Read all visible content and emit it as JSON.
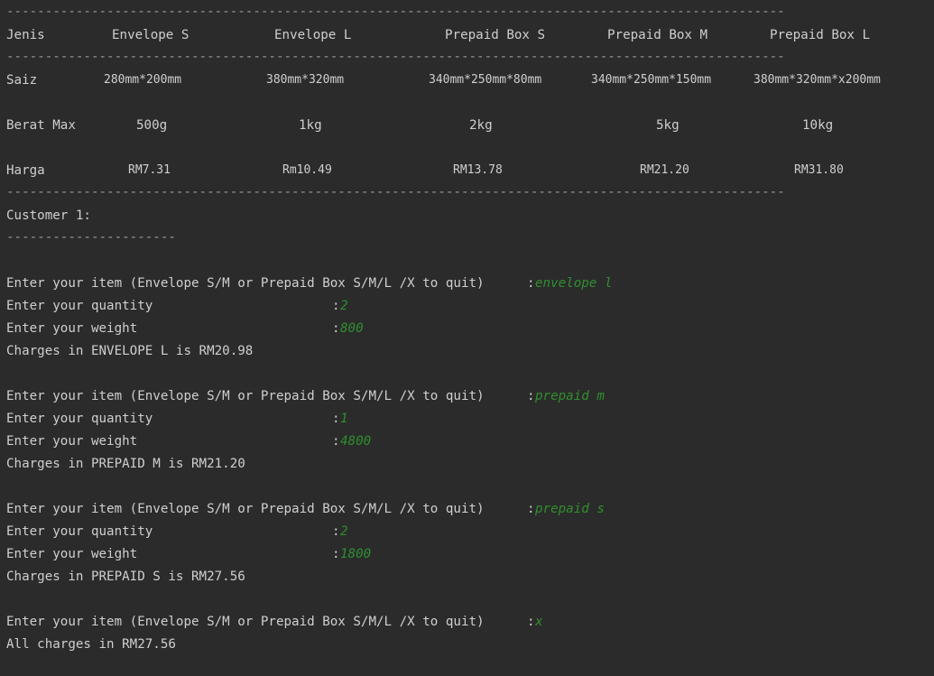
{
  "separator_long": "-----------------------------------------------------------------------------------------------------",
  "separator_short": "----------------------",
  "table": {
    "headers": [
      "Jenis",
      "Envelope S",
      "Envelope L",
      "Prepaid Box S",
      "Prepaid Box M",
      "Prepaid Box L"
    ],
    "saiz": [
      "Saiz",
      "280mm*200mm",
      "380mm*320mm",
      "340mm*250mm*80mm",
      "340mm*250mm*150mm",
      "380mm*320mm*x200mm"
    ],
    "berat": [
      "Berat Max",
      "500g",
      "1kg",
      "2kg",
      "5kg",
      "10kg"
    ],
    "harga": [
      "Harga",
      "RM7.31",
      "Rm10.49",
      "RM13.78",
      "RM21.20",
      "RM31.80"
    ]
  },
  "customer_label": "Customer 1:",
  "prompts": {
    "item": "Enter your item (Envelope S/M or Prepaid Box S/M/L /X to quit)",
    "quantity": "Enter your quantity",
    "weight": "Enter your weight",
    "colon": ":"
  },
  "entries": [
    {
      "item": "envelope l",
      "quantity": "2",
      "weight": "800",
      "result": "Charges in ENVELOPE L is RM20.98"
    },
    {
      "item": "prepaid m",
      "quantity": "1",
      "weight": "4800",
      "result": "Charges in PREPAID M is RM21.20"
    },
    {
      "item": "prepaid s",
      "quantity": "2",
      "weight": "1800",
      "result": "Charges in PREPAID S is RM27.56"
    }
  ],
  "final_item": "x",
  "total": "All charges in RM27.56",
  "colors": {
    "background": "#2b2b2b",
    "text": "#cfcfcf",
    "input": "#2f8f2f"
  }
}
